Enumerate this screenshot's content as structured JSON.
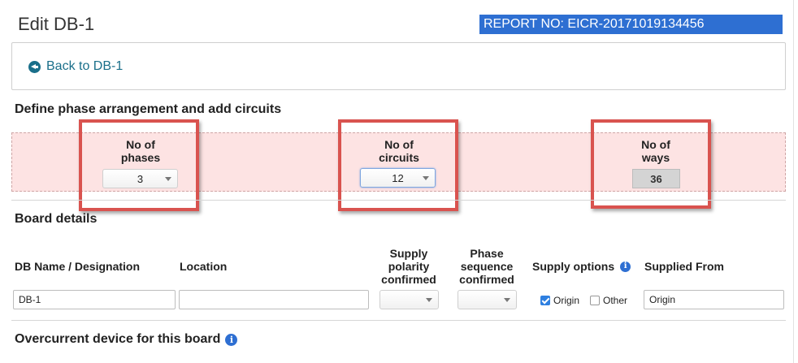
{
  "page": {
    "title": "Edit DB-1",
    "report_badge": "REPORT NO: EICR-20171019134456"
  },
  "nav": {
    "back_label": "Back to DB-1"
  },
  "phase_section": {
    "heading": "Define phase arrangement and add circuits",
    "phases": {
      "label_line1": "No of",
      "label_line2": "phases",
      "value": "3"
    },
    "circuits": {
      "label_line1": "No of",
      "label_line2": "circuits",
      "value": "12"
    },
    "ways": {
      "label_line1": "No of",
      "label_line2": "ways",
      "value": "36"
    }
  },
  "board_details": {
    "heading": "Board details",
    "columns": {
      "name": "DB Name / Designation",
      "location": "Location",
      "polarity_line1": "Supply",
      "polarity_line2": "polarity",
      "polarity_line3": "confirmed",
      "sequence_line1": "Phase",
      "sequence_line2": "sequence",
      "sequence_line3": "confirmed",
      "supply_options": "Supply options",
      "supplied_from": "Supplied From"
    },
    "values": {
      "name": "DB-1",
      "location": "",
      "polarity": "",
      "sequence": "",
      "supplied_from": "Origin"
    },
    "supply_options": {
      "origin_label": "Origin",
      "origin_checked": true,
      "other_label": "Other",
      "other_checked": false
    }
  },
  "overcurrent": {
    "heading": "Overcurrent device for this board"
  },
  "icons": {
    "back": "arrow-circle-left-icon",
    "info": "info-icon",
    "caret": "chevron-down-icon"
  },
  "colors": {
    "badge_bg": "#2e6fd2",
    "highlight_border": "#d9534f",
    "phase_band_bg": "#fde3e3",
    "link": "#1a6f8a"
  }
}
